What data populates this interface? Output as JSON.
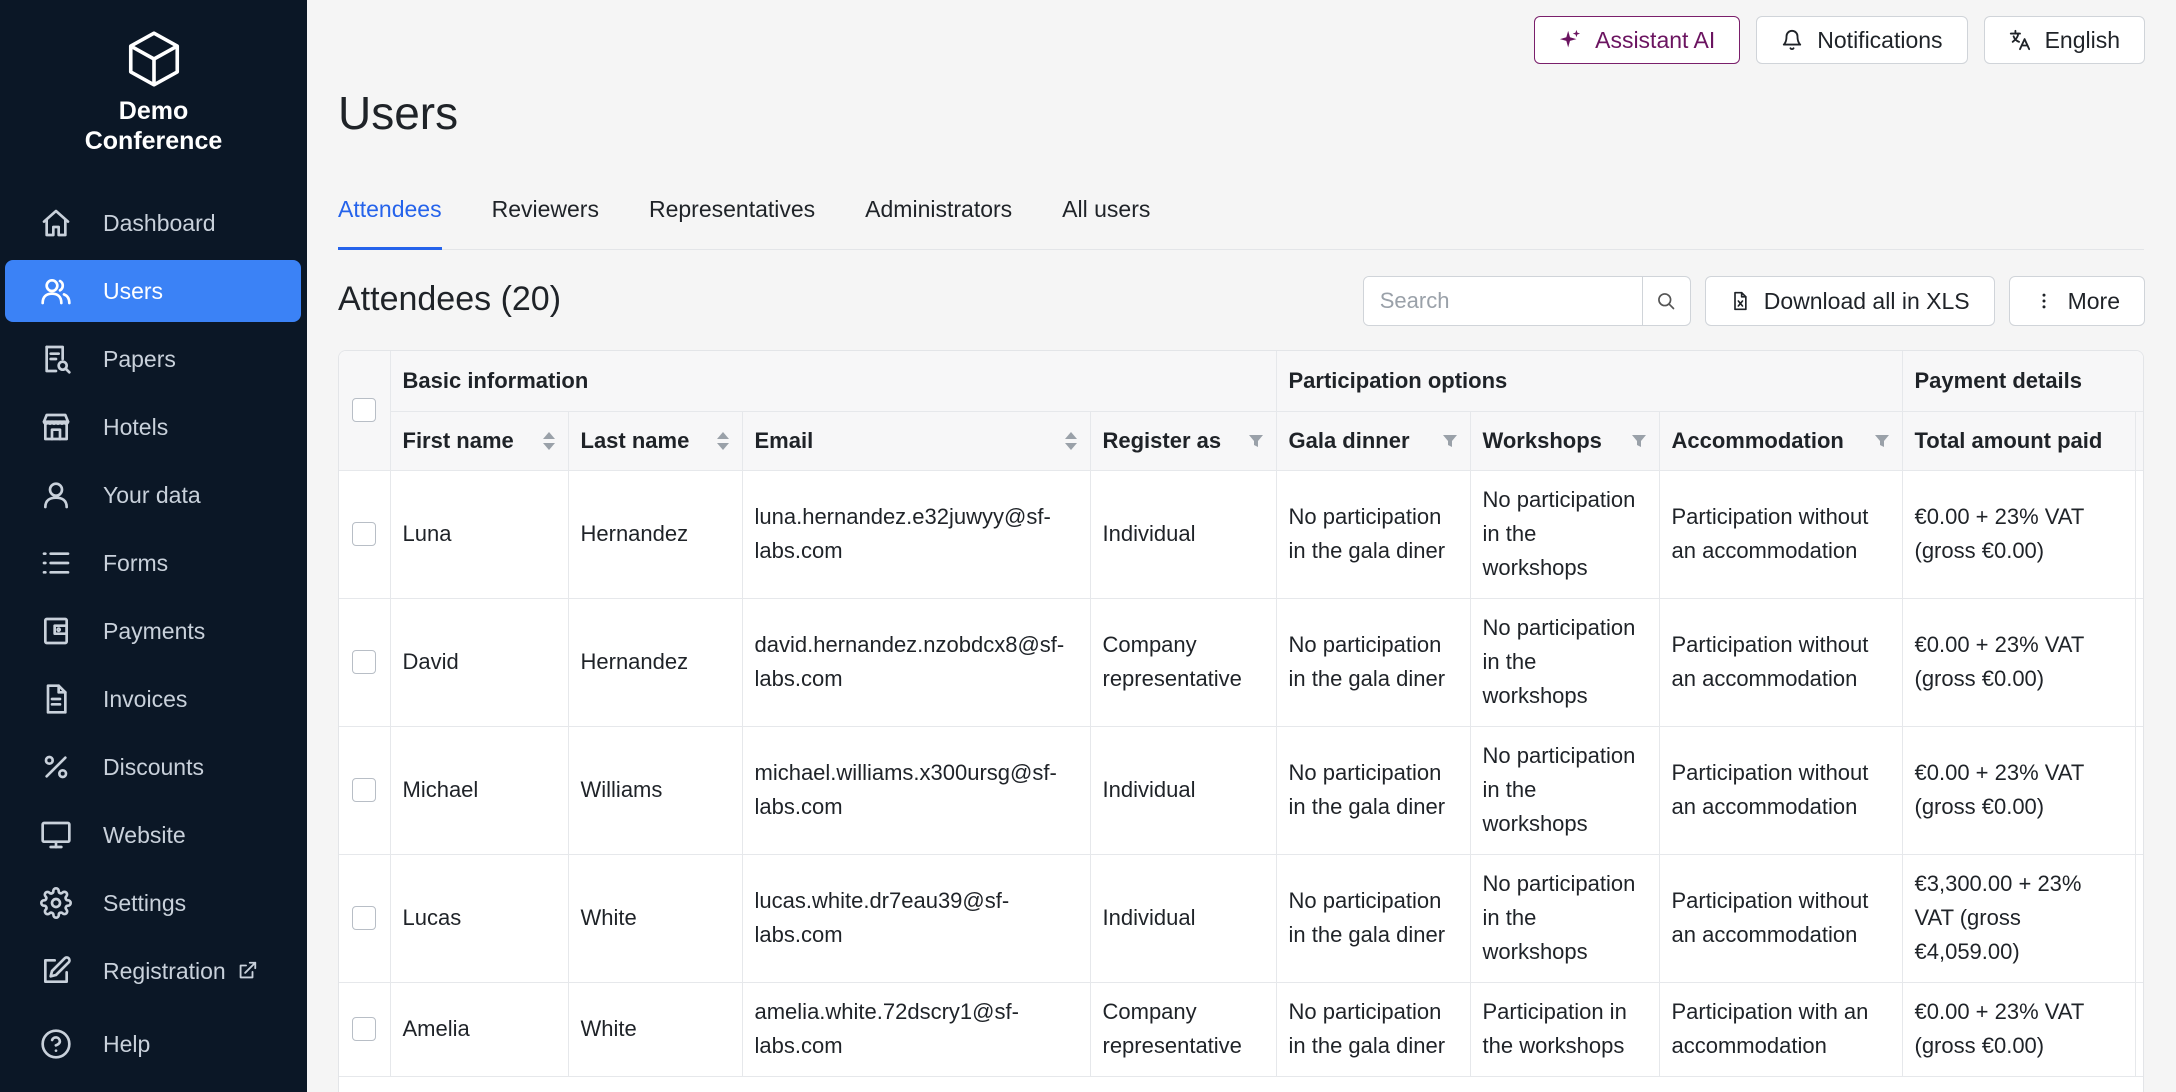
{
  "app": {
    "logo_line1": "Demo",
    "logo_line2": "Conference"
  },
  "sidebar": {
    "items": [
      {
        "label": "Dashboard",
        "icon": "home-icon"
      },
      {
        "label": "Users",
        "icon": "users-icon",
        "active": true
      },
      {
        "label": "Papers",
        "icon": "papers-icon"
      },
      {
        "label": "Hotels",
        "icon": "hotel-icon"
      },
      {
        "label": "Your data",
        "icon": "user-icon"
      },
      {
        "label": "Forms",
        "icon": "list-icon"
      },
      {
        "label": "Payments",
        "icon": "wallet-icon"
      },
      {
        "label": "Invoices",
        "icon": "document-icon"
      },
      {
        "label": "Discounts",
        "icon": "percent-icon"
      },
      {
        "label": "Website",
        "icon": "monitor-icon"
      },
      {
        "label": "Settings",
        "icon": "gear-icon"
      },
      {
        "label": "Registration",
        "icon": "edit-icon"
      }
    ],
    "help_label": "Help"
  },
  "topbar": {
    "assistant_label": "Assistant AI",
    "notifications_label": "Notifications",
    "language_label": "English"
  },
  "page": {
    "title": "Users",
    "tabs": [
      "Attendees",
      "Reviewers",
      "Representatives",
      "Administrators",
      "All users"
    ],
    "active_tab": "Attendees",
    "section_title": "Attendees (20)",
    "search_placeholder": "Search",
    "download_label": "Download all in XLS",
    "more_label": "More"
  },
  "table": {
    "groups": [
      "Basic information",
      "Participation options",
      "Payment details"
    ],
    "columns": [
      "First name",
      "Last name",
      "Email",
      "Register as",
      "Gala dinner",
      "Workshops",
      "Accommodation",
      "Total amount paid"
    ],
    "rows": [
      {
        "first": "Luna",
        "last": "Hernandez",
        "email": "luna.hernandez.e32juwyy@sf-labs.com",
        "register": "Individual",
        "gala": "No participation in the gala diner",
        "workshops": "No participation in the workshops",
        "accommodation": "Participation without an accommodation",
        "paid": "€0.00 + 23% VAT (gross €0.00)"
      },
      {
        "first": "David",
        "last": "Hernandez",
        "email": "david.hernandez.nzobdcx8@sf-labs.com",
        "register": "Company representative",
        "gala": "No participation in the gala diner",
        "workshops": "No participation in the workshops",
        "accommodation": "Participation without an accommodation",
        "paid": "€0.00 + 23% VAT (gross €0.00)"
      },
      {
        "first": "Michael",
        "last": "Williams",
        "email": "michael.williams.x300ursg@sf-labs.com",
        "register": "Individual",
        "gala": "No participation in the gala diner",
        "workshops": "No participation in the workshops",
        "accommodation": "Participation without an accommodation",
        "paid": "€0.00 + 23% VAT (gross €0.00)"
      },
      {
        "first": "Lucas",
        "last": "White",
        "email": "lucas.white.dr7eau39@sf-labs.com",
        "register": "Individual",
        "gala": "No participation in the gala diner",
        "workshops": "No participation in the workshops",
        "accommodation": "Participation without an accommodation",
        "paid": "€3,300.00 + 23% VAT (gross €4,059.00)"
      },
      {
        "first": "Amelia",
        "last": "White",
        "email": "amelia.white.72dscry1@sf-labs.com",
        "register": "Company representative",
        "gala": "No participation in the gala diner",
        "workshops": "Participation in the workshops",
        "accommodation": "Participation with an accommodation",
        "paid": "€0.00 + 23% VAT (gross €0.00)"
      }
    ]
  },
  "colors": {
    "sidebar_bg": "#0b1726",
    "active_nav": "#3b82f6",
    "tab_active": "#2563eb",
    "assistant_accent": "#7a1f6b"
  }
}
